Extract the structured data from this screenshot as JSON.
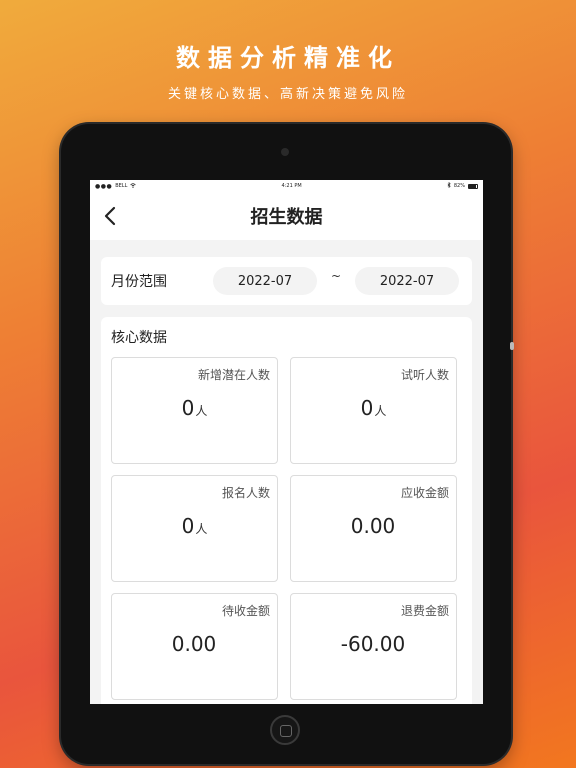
{
  "promo": {
    "title": "数据分析精准化",
    "subtitle": "关键核心数据、高新决策避免风险"
  },
  "status_bar": {
    "carrier": "BELL",
    "time": "4:21 PM",
    "battery": "82%"
  },
  "nav": {
    "title": "招生数据",
    "back_icon": "chevron-left-icon"
  },
  "date_range": {
    "label": "月份范围",
    "start": "2022-07",
    "separator": "~",
    "end": "2022-07"
  },
  "core": {
    "title": "核心数据",
    "stats": [
      {
        "label": "新增潜在人数",
        "value": "0",
        "unit": "人"
      },
      {
        "label": "试听人数",
        "value": "0",
        "unit": "人"
      },
      {
        "label": "报名人数",
        "value": "0",
        "unit": "人"
      },
      {
        "label": "应收金额",
        "value": "0.00",
        "unit": ""
      },
      {
        "label": "待收金额",
        "value": "0.00",
        "unit": ""
      },
      {
        "label": "退费金额",
        "value": "-60.00",
        "unit": ""
      }
    ]
  },
  "colors": {
    "gradient_start": "#f0ab3c",
    "gradient_end": "#e9553d",
    "tablet_frame": "#111111",
    "screen_background": "#f3f3f3"
  }
}
